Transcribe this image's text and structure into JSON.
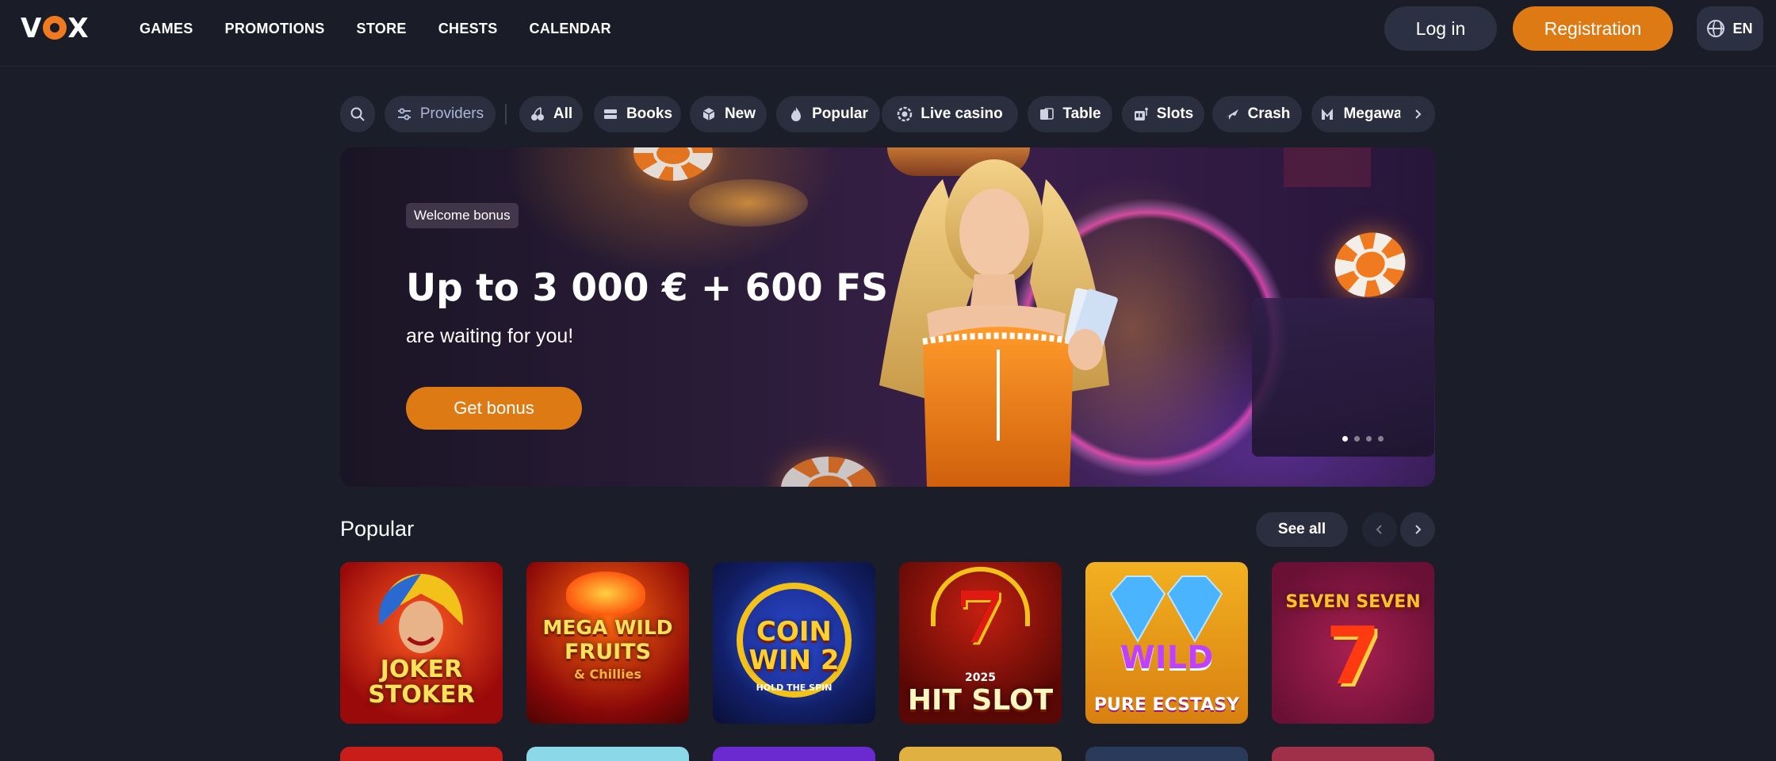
{
  "header": {
    "logo": "VOX",
    "nav": [
      "GAMES",
      "PROMOTIONS",
      "STORE",
      "CHESTS",
      "CALENDAR"
    ],
    "login_label": "Log in",
    "register_label": "Registration",
    "language": "EN",
    "accent_color": "#de7a14"
  },
  "filters": {
    "search_icon": "search-icon",
    "providers_label": "Providers",
    "categories": [
      {
        "label": "All",
        "icon": "cherries-icon"
      },
      {
        "label": "Books",
        "icon": "books-icon"
      },
      {
        "label": "New",
        "icon": "cube-icon"
      },
      {
        "label": "Popular",
        "icon": "flame-icon"
      },
      {
        "label": "Live casino",
        "icon": "chip-icon"
      },
      {
        "label": "Table",
        "icon": "cards-icon"
      },
      {
        "label": "Slots",
        "icon": "slot-machine-icon"
      },
      {
        "label": "Crash",
        "icon": "plane-icon"
      },
      {
        "label": "Megaways",
        "icon": "megaways-icon"
      }
    ]
  },
  "banner": {
    "badge": "Welcome bonus",
    "headline": "Up to 3 000 € + 600 FS",
    "subtitle": "are waiting for you!",
    "cta_label": "Get bonus",
    "slides_total": 4,
    "active_slide": 1
  },
  "popular": {
    "title": "Popular",
    "see_all_label": "See all",
    "games": [
      {
        "name": "JOKER STOKER",
        "line1": "JOKER",
        "line2": "STOKER",
        "bg": "#b01818"
      },
      {
        "name": "MEGA WILD FRUITS & Chillies",
        "line1": "MEGA WILD",
        "line2": "FRUITS",
        "line3": "& Chillies",
        "bg": "#9a0e0e"
      },
      {
        "name": "COIN WIN 2 HOLD THE SPIN",
        "line1": "COIN",
        "line2": "WIN 2",
        "line3": "HOLD THE SPIN",
        "bg": "#12206a"
      },
      {
        "name": "2025 HIT SLOT",
        "line1": "2025",
        "line2": "HIT SLOT",
        "bg": "#7a0f0a"
      },
      {
        "name": "WILD PURE ECSTASY",
        "line1": "WILD",
        "line2": "PURE ECSTASY",
        "bg": "#e0a018"
      },
      {
        "name": "SEVEN SEVEN",
        "line1": "SEVEN SEVEN",
        "line2": "7",
        "bg": "#7a1540"
      }
    ]
  }
}
